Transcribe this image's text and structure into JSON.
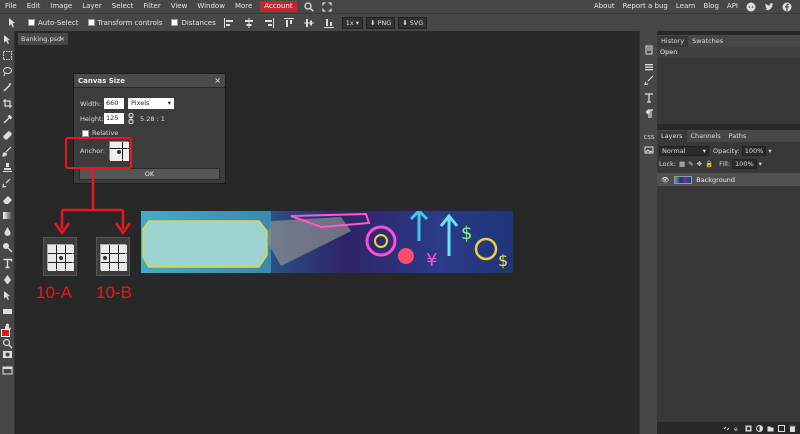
{
  "menubar": {
    "items": [
      "File",
      "Edit",
      "Image",
      "Layer",
      "Select",
      "Filter",
      "View",
      "Window",
      "More"
    ],
    "account": "Account",
    "right_links": [
      "About",
      "Report a bug",
      "Learn",
      "Blog",
      "API"
    ]
  },
  "options": {
    "auto_select": "Auto-Select",
    "transform_controls": "Transform controls",
    "distances": "Distances",
    "zoom": "1x",
    "png": "PNG",
    "svg": "SVG"
  },
  "document_tab": {
    "name": "Banking.psd"
  },
  "dialog": {
    "title": "Canvas Size",
    "width_label": "Width:",
    "width_value": "660",
    "unit": "Pixels",
    "height_label": "Height:",
    "height_value": "125",
    "ratio": "5.28 : 1",
    "relative_label": "Relative",
    "anchor_label": "Anchor:",
    "ok_label": "OK"
  },
  "annotations": {
    "label_a": "10-A",
    "label_b": "10-B"
  },
  "history_panel": {
    "tabs": [
      "History",
      "Swatches"
    ],
    "items": [
      "Open"
    ]
  },
  "layers_panel": {
    "tabs": [
      "Layers",
      "Channels",
      "Paths"
    ],
    "blend_mode": "Normal",
    "opacity_label": "Opacity:",
    "opacity_value": "100%",
    "lock_label": "Lock:",
    "fill_label": "Fill:",
    "fill_value": "100%",
    "layers": [
      "Background"
    ]
  },
  "right_strip": {
    "css_label": "CSS"
  },
  "colors": {
    "foreground": "#e8191c",
    "background": "#000000",
    "accent": "#c0262d"
  }
}
